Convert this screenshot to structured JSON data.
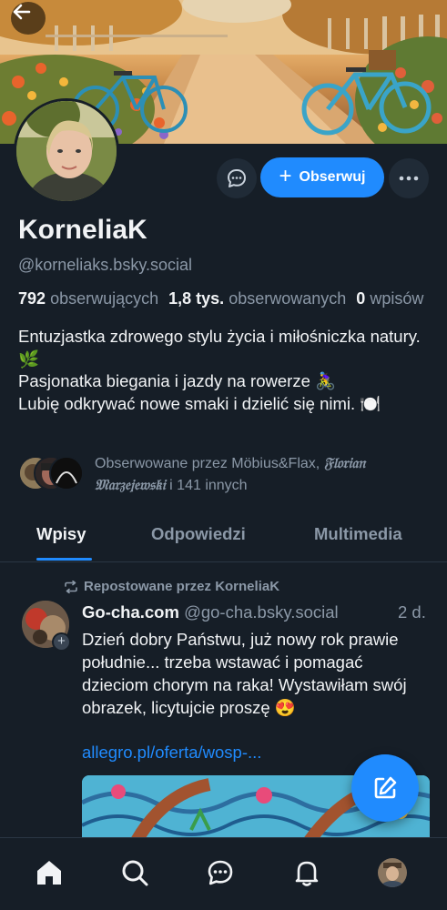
{
  "profile": {
    "display_name": "KorneliaK",
    "handle": "@korneliaks.bsky.social",
    "followers_count": "792",
    "followers_label": "obserwujących",
    "following_count": "1,8 tys.",
    "following_label": "obserwowanych",
    "posts_count": "0",
    "posts_label": "wpisów",
    "bio": [
      "Entuzjastka zdrowego stylu życia i miłośniczka natury. 🌿",
      "Pasjonatka biegania i jazdy na rowerze 🚴‍♀️",
      "Lubię odkrywać nowe smaki i dzielić się nimi. 🍽️"
    ],
    "known_followers_prefix": "Obserwowane przez Möbius&Flax, ",
    "known_followers_fancy": "𝔉𝔩𝔬𝔯𝔦𝔞𝔫 𝔐𝔞𝔯𝔷𝔢𝔧𝔢𝔴𝔰𝔨𝔦",
    "known_followers_suffix": " i 141 innych"
  },
  "actions": {
    "follow_label": "Obserwuj"
  },
  "tabs": [
    {
      "label": "Wpisy",
      "active": true
    },
    {
      "label": "Odpowiedzi",
      "active": false
    },
    {
      "label": "Multimedia",
      "active": false
    }
  ],
  "post": {
    "repost_label": "Repostowane przez KorneliaK",
    "author": "Go-cha.com",
    "author_handle": "@go-cha.bsky.social",
    "time": "2 d.",
    "body": "Dzień dobry Państwu, już nowy rok prawie południe... trzeba wstawać i pomagać dzieciom chorym na raka! Wystawiłam swój obrazek, licytujcie proszę 😍",
    "link": "allegro.pl/oferta/wosp-..."
  },
  "icons": {
    "back": "arrow-left-icon",
    "chat": "chat-bubble-icon",
    "more": "ellipsis-icon",
    "repost": "repost-icon",
    "compose": "compose-icon",
    "nav": [
      "home-icon",
      "search-icon",
      "chat-icon",
      "bell-icon",
      "profile-avatar"
    ]
  },
  "colors": {
    "background": "#161e27",
    "accent": "#208bfe",
    "muted_text": "#8b98a7",
    "primary_text": "#f1f3f5"
  }
}
